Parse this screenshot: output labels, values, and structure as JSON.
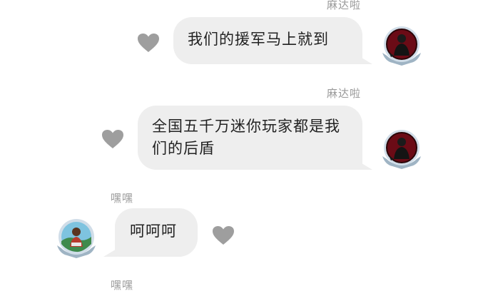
{
  "messages": [
    {
      "sender": "麻达啦",
      "text": "我们的援军马上就到",
      "side": "right"
    },
    {
      "sender": "麻达啦",
      "text": "全国五千万迷你玩家都是我们的后盾",
      "side": "right"
    },
    {
      "sender": "嘿嘿",
      "text": "呵呵呵",
      "side": "left"
    },
    {
      "sender": "嘿嘿",
      "text": "",
      "side": "left"
    }
  ],
  "colors": {
    "bubble": "#eeeeee",
    "heart": "#9e9e9e",
    "name": "#9a9a9a"
  },
  "icons": {
    "like": "heart-icon"
  }
}
